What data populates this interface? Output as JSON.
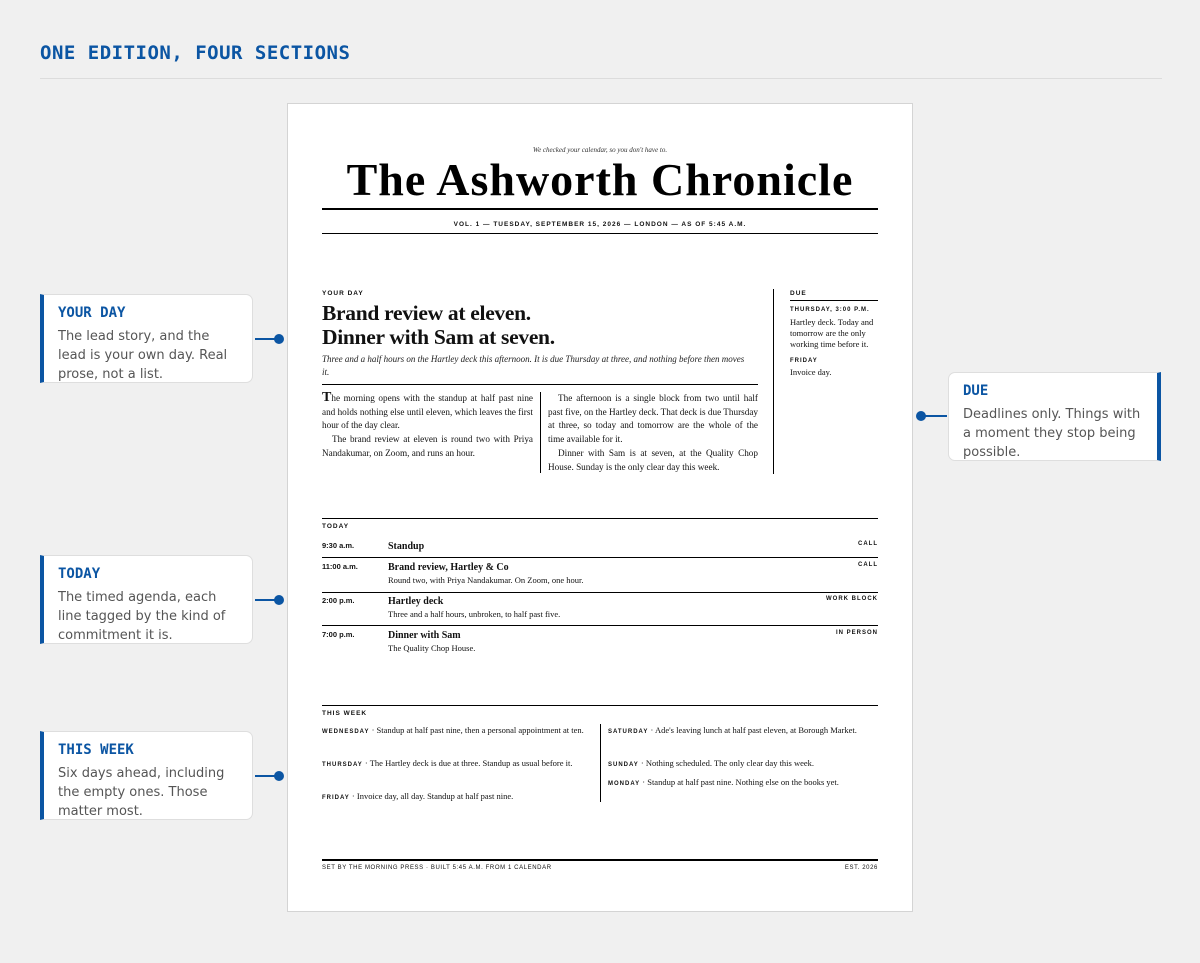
{
  "page_header": "ONE EDITION, FOUR SECTIONS",
  "callouts": [
    {
      "title": "YOUR DAY",
      "body": "The lead story, and the lead is your own day. Real prose, not a list."
    },
    {
      "title": "TODAY",
      "body": "The timed agenda, each line tagged by the kind of commitment it is."
    },
    {
      "title": "THIS WEEK",
      "body": "Six days ahead, including the empty ones. Those matter most."
    },
    {
      "title": "DUE",
      "body": "Deadlines only. Things with a moment they stop being possible."
    }
  ],
  "paper": {
    "tagline": "We checked your calendar, so you don't have to.",
    "masthead": "The Ashworth Chronicle",
    "dateline": "VOL. 1 — TUESDAY, SEPTEMBER 15, 2026 — LONDON — AS OF 5:45 A.M.",
    "your_day": {
      "kicker": "YOUR DAY",
      "headline_1": "Brand review at eleven.",
      "headline_2": "Dinner with Sam at seven.",
      "deck": "Three and a half hours on the Hartley deck this afternoon. It is due Thursday at three, and nothing before then moves it.",
      "dropcap": "T",
      "col1_p1_rest": "he morning opens with the standup at half past nine and holds nothing else until eleven, which leaves the first hour of the day clear.",
      "col1_p2": "The brand review at eleven is round two with Priya Nandakumar, on Zoom, and runs an hour.",
      "col2_p1": "The afternoon is a single block from two until half past five, on the Hartley deck. That deck is due Thursday at three, so today and tomorrow are the whole of the time available for it.",
      "col2_p2": "Dinner with Sam is at seven, at the Quality Chop House. Sunday is the only clear day this week."
    },
    "due": {
      "kicker": "DUE",
      "items": [
        {
          "when": "THURSDAY, 3:00 P.M.",
          "text": "Hartley deck. Today and tomorrow are the only working time before it."
        },
        {
          "when": "FRIDAY",
          "text": "Invoice day."
        }
      ]
    },
    "today": {
      "kicker": "TODAY",
      "items": [
        {
          "time": "9:30 a.m.",
          "title": "Standup",
          "desc": "",
          "type": "CALL"
        },
        {
          "time": "11:00 a.m.",
          "title": "Brand review, Hartley & Co",
          "desc": "Round two, with Priya Nandakumar. On Zoom, one hour.",
          "type": "CALL"
        },
        {
          "time": "2:00 p.m.",
          "title": "Hartley deck",
          "desc": "Three and a half hours, unbroken, to half past five.",
          "type": "WORK BLOCK"
        },
        {
          "time": "7:00 p.m.",
          "title": "Dinner with Sam",
          "desc": "The Quality Chop House.",
          "type": "IN PERSON"
        }
      ]
    },
    "this_week": {
      "kicker": "THIS WEEK",
      "left": [
        {
          "day": "WEDNESDAY",
          "text": "Standup at half past nine, then a personal appointment at ten."
        },
        {
          "day": "THURSDAY",
          "text": "The Hartley deck is due at three. Standup as usual before it."
        },
        {
          "day": "FRIDAY",
          "text": "Invoice day, all day. Standup at half past nine."
        }
      ],
      "right": [
        {
          "day": "SATURDAY",
          "text": "Ade's leaving lunch at half past eleven, at Borough Market."
        },
        {
          "day": "SUNDAY",
          "text": "Nothing scheduled. The only clear day this week."
        },
        {
          "day": "MONDAY",
          "text": "Standup at half past nine. Nothing else on the books yet."
        }
      ]
    },
    "footer_left": "SET BY THE MORNING PRESS · BUILT 5:45 A.M. FROM 1 CALENDAR",
    "footer_right": "EST. 2026"
  },
  "colors": {
    "accent": "#0b55a3",
    "background": "#f0f0f0"
  }
}
